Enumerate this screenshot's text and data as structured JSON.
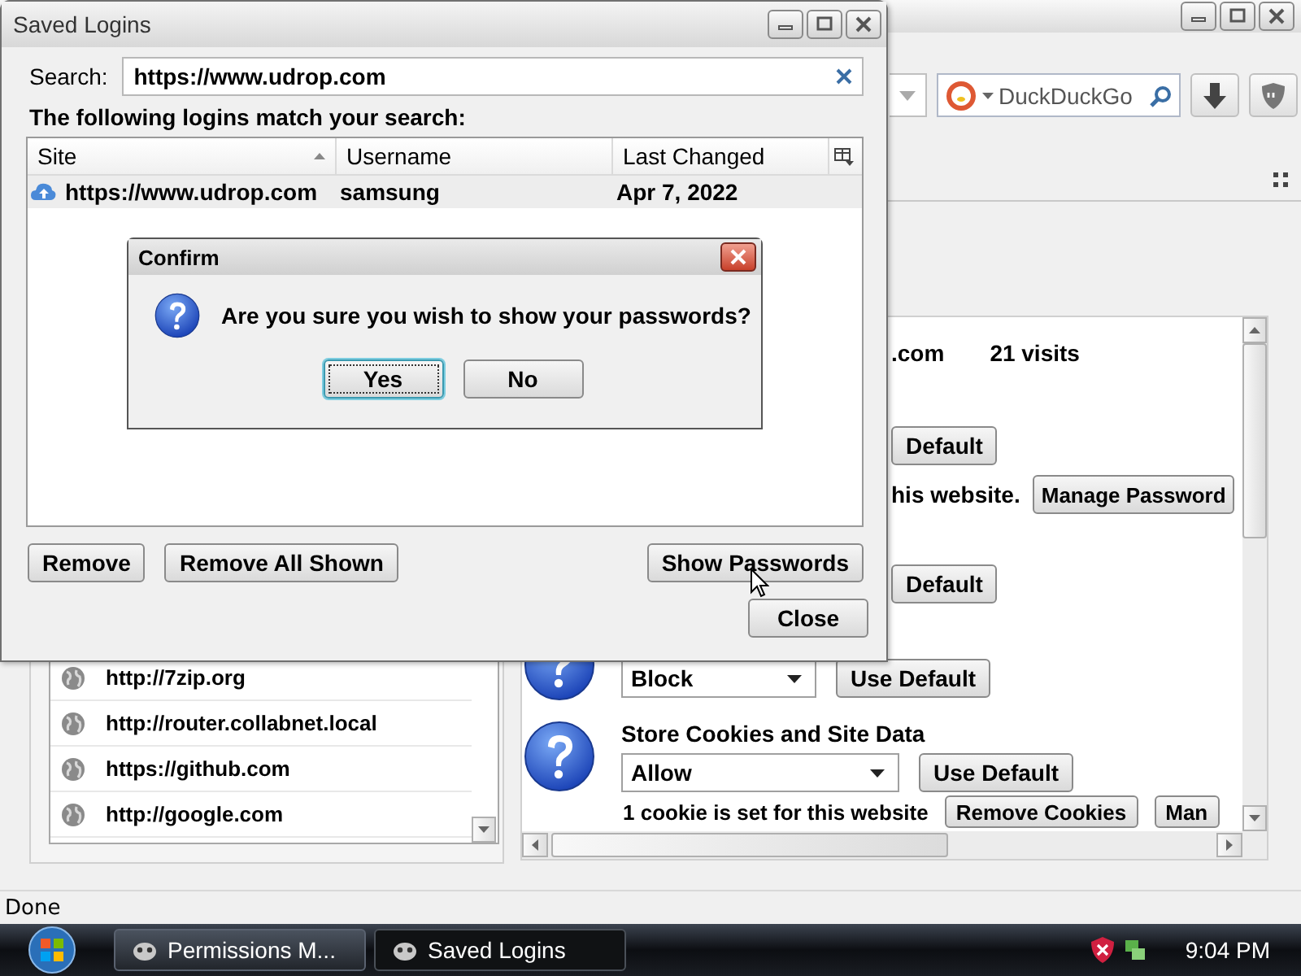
{
  "browser": {
    "search_field": {
      "placeholder": "DuckDuckGo"
    },
    "permissions": {
      "site_row": {
        "site": ".com",
        "visits": "21 visits"
      },
      "rows": [
        {
          "kind": "button",
          "label": "Default"
        },
        {
          "kind": "text_button",
          "text": "his website.",
          "button": "Manage Password"
        },
        {
          "kind": "button",
          "label": "Default"
        },
        {
          "kind": "select",
          "value": "Block",
          "button": "Use Default"
        },
        {
          "kind": "select",
          "title": "Store Cookies and Site Data",
          "value": "Allow",
          "button": "Use Default"
        },
        {
          "kind": "text_buttons",
          "text": "1 cookie is set for this website",
          "buttons": [
            "Remove Cookies",
            "Man"
          ]
        }
      ]
    },
    "site_list": [
      "http://7zip.org",
      "http://router.collabnet.local",
      "https://github.com",
      "http://google.com"
    ],
    "status_bar": "Done"
  },
  "saved_logins": {
    "title": "Saved Logins",
    "search_label": "Search:",
    "search_value": "https://www.udrop.com",
    "hint": "The following logins match your search:",
    "columns": [
      "Site",
      "Username",
      "Last Changed"
    ],
    "rows": [
      {
        "site": "https://www.udrop.com",
        "username": "samsung",
        "last_changed": "Apr 7, 2022",
        "selected": true
      }
    ],
    "buttons": [
      "Remove",
      "Remove All Shown",
      "Show Passwords"
    ],
    "close_button": "Close"
  },
  "confirm": {
    "title": "Confirm",
    "message": "Are you sure you wish to show your passwords?",
    "buttons": [
      {
        "label": "Yes",
        "focused": true
      },
      {
        "label": "No",
        "focused": false
      }
    ]
  },
  "taskbar": {
    "tasks": [
      {
        "label": "Permissions M...",
        "selected": false
      },
      {
        "label": "Saved Logins",
        "selected": true
      }
    ],
    "clock": "9:04 PM"
  }
}
